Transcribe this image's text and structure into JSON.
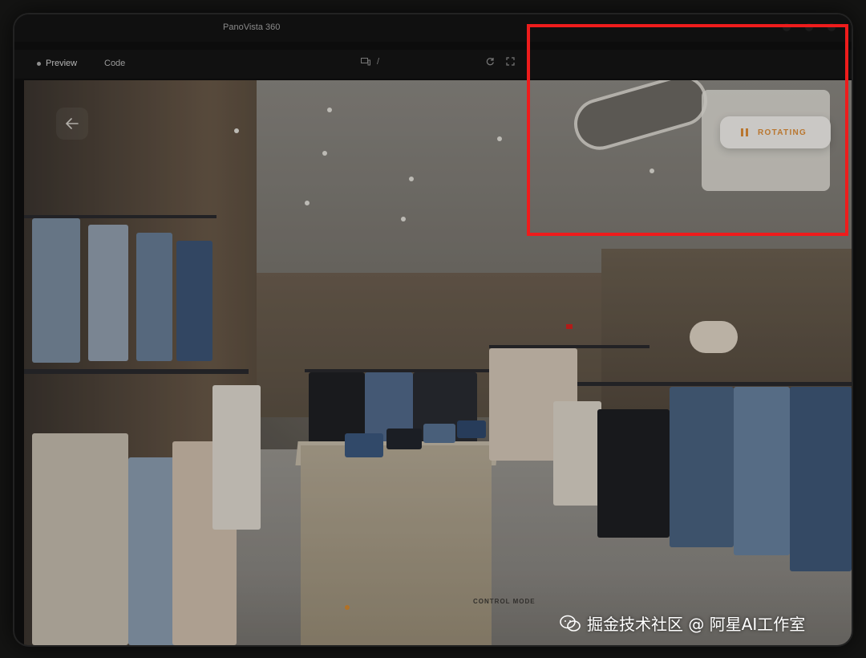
{
  "window": {
    "title": "PanoVista 360"
  },
  "toolbar": {
    "tabs": [
      {
        "label": "Preview",
        "active": true
      },
      {
        "label": "Code",
        "active": false
      }
    ],
    "path_separator": "/",
    "icons": [
      "device-icon",
      "refresh-icon",
      "fullscreen-icon"
    ]
  },
  "viewer": {
    "back_icon": "arrow-left-icon",
    "rotation_toggle": {
      "label": "ROTATING",
      "icon": "pause-icon",
      "accent_color": "#e2913a"
    },
    "control_mode": {
      "label": "CONTROL MODE"
    }
  },
  "annotation": {
    "highlight_color": "#ee1c1c"
  },
  "watermark": {
    "text": "掘金技术社区 @ 阿星AI工作室",
    "icon": "wechat-icon"
  }
}
